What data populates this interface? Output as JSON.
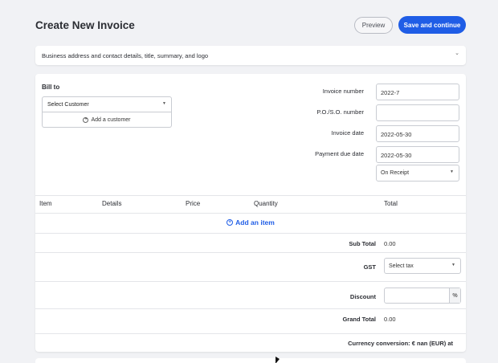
{
  "header": {
    "title": "Create New Invoice",
    "preview_label": "Preview",
    "save_label": "Save and continue"
  },
  "business": {
    "summary": "Business address and contact details, title, summary, and logo",
    "chevron_icon": "chevron-down-icon"
  },
  "bill_to": {
    "label": "Bill to",
    "select_placeholder": "Select Customer",
    "add_customer_label": "Add a customer"
  },
  "fields": {
    "invoice_number_label": "Invoice number",
    "invoice_number_value": "2022-7",
    "po_label": "P.O./S.O. number",
    "po_value": "",
    "invoice_date_label": "Invoice date",
    "invoice_date_value": "2022-05-30",
    "due_date_label": "Payment due date",
    "due_date_value": "2022-05-30",
    "terms_value": "On Receipt"
  },
  "items": {
    "columns": [
      "Item",
      "Details",
      "Price",
      "Quantity",
      "Total"
    ],
    "add_item_label": "Add an item"
  },
  "totals": {
    "subtotal_label": "Sub Total",
    "subtotal_value": "0.00",
    "gst_label": "GST",
    "gst_select": "Select tax",
    "discount_label": "Discount",
    "discount_value": "",
    "discount_unit": "%",
    "grand_total_label": "Grand Total",
    "grand_total_value": "0.00",
    "currency_conversion": "Currency conversion: € nan (EUR) at"
  },
  "colors": {
    "accent": "#1f5de6",
    "background": "#f1f2f5"
  }
}
